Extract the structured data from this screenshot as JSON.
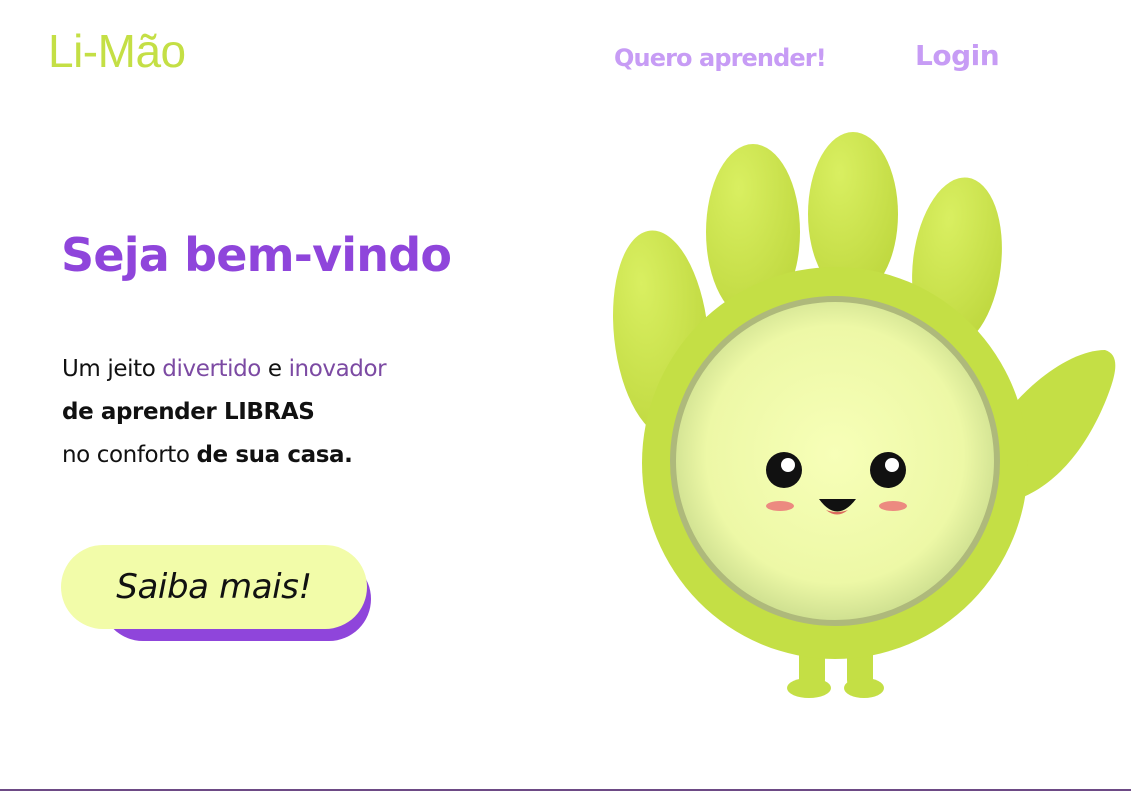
{
  "header": {
    "logo": "Li-Mão",
    "nav": {
      "learn": "Quero aprender!",
      "login": "Login"
    }
  },
  "hero": {
    "title": "Seja bem-vindo",
    "tagline": {
      "line1_part1": "Um jeito ",
      "line1_part2": "divertido",
      "line1_part3": " e ",
      "line1_part4": "inovador",
      "line2": "de aprender LIBRAS",
      "line3_part1": "no conforto ",
      "line3_part2": "de sua casa."
    },
    "cta_label": "Saiba mais!"
  },
  "mascot": {
    "icon": "hand-mascot"
  },
  "colors": {
    "brand_green": "#c4df45",
    "accent_purple": "#8f45db",
    "nav_lavender": "#c79cf5",
    "cta_background": "#f2fca9"
  }
}
